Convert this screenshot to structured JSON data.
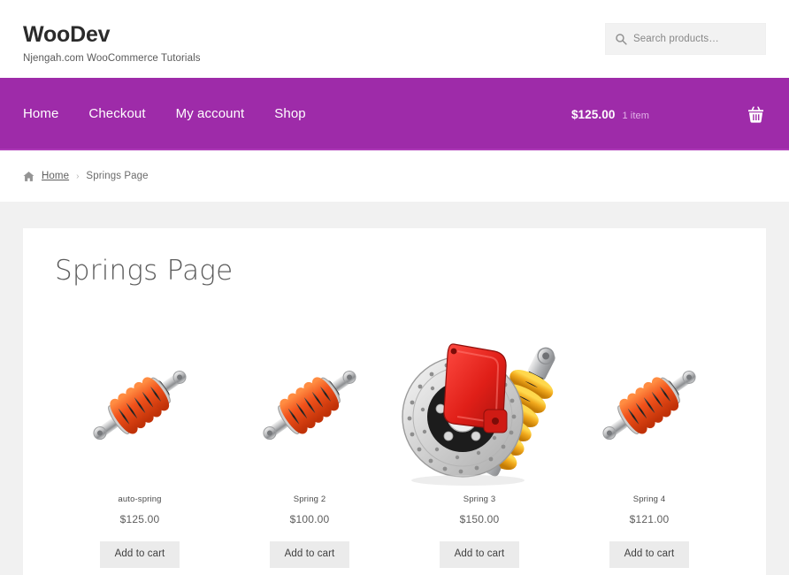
{
  "header": {
    "brand_title": "WooDev",
    "brand_tagline": "Njengah.com WooCommerce Tutorials",
    "search": {
      "icon": "search-icon",
      "placeholder": "Search products…",
      "value": ""
    }
  },
  "nav": {
    "items": [
      {
        "label": "Home"
      },
      {
        "label": "Checkout"
      },
      {
        "label": "My account"
      },
      {
        "label": "Shop"
      }
    ],
    "cart": {
      "total": "$125.00",
      "count": "1 item",
      "icon": "shopping-basket-icon"
    },
    "accent_color": "#9e2ba9"
  },
  "breadcrumb": {
    "home_icon": "home-icon",
    "home_label": "Home",
    "separator": "›",
    "current": "Springs Page"
  },
  "main": {
    "page_title": "Springs Page",
    "products": [
      {
        "title": "auto-spring",
        "price": "$125.00",
        "image": "coilover-shock-absorber-orange",
        "button_label": "Add to cart"
      },
      {
        "title": "Spring 2",
        "price": "$100.00",
        "image": "coilover-shock-absorber-orange",
        "button_label": "Add to cart"
      },
      {
        "title": "Spring 3",
        "price": "$150.00",
        "image": "brake-rotor-red-caliper-yellow-coilover",
        "button_label": "Add to cart"
      },
      {
        "title": "Spring 4",
        "price": "$121.00",
        "image": "coilover-shock-absorber-orange",
        "button_label": "Add to cart"
      }
    ]
  }
}
